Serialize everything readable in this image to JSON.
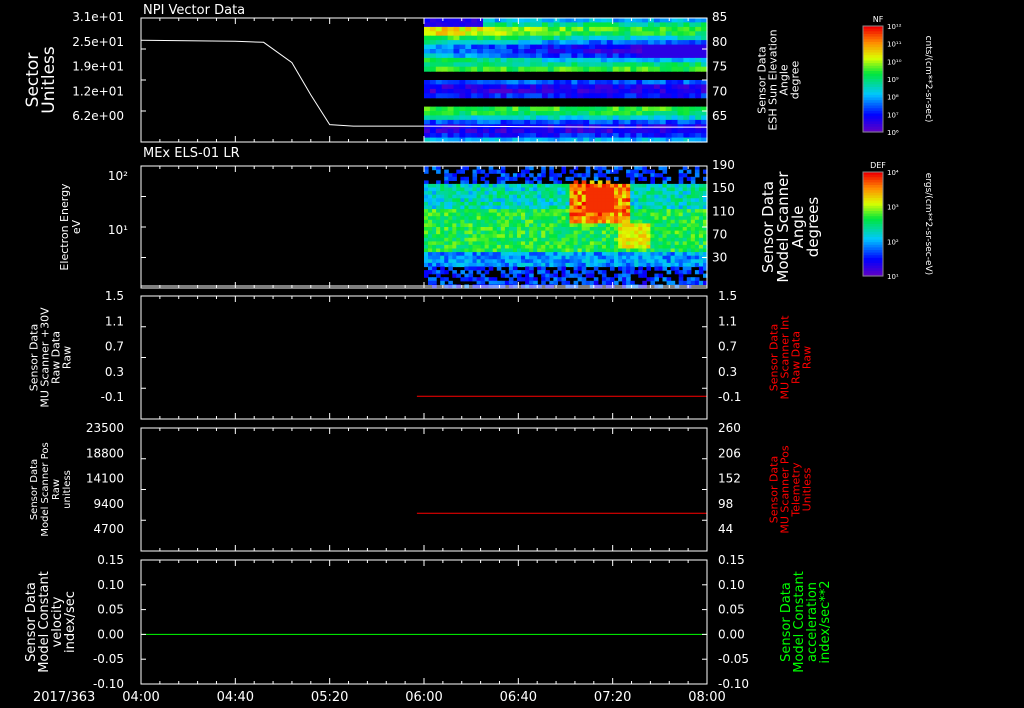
{
  "date_label": "2017/363",
  "x_ticks": [
    "04:00",
    "04:40",
    "05:20",
    "06:00",
    "06:40",
    "07:20",
    "08:00"
  ],
  "colorbars": [
    {
      "tag": "NF",
      "unit": "cnts/(cm**2-sr-sec)",
      "ticks": [
        "10¹²",
        "10¹¹",
        "10¹⁰",
        "10⁹",
        "10⁸",
        "10⁷",
        "10⁶"
      ]
    },
    {
      "tag": "DEF",
      "unit": "ergs/(cm**2-sr-sec-eV)",
      "ticks": [
        "10⁴",
        "10³",
        "10²",
        "10¹"
      ]
    }
  ],
  "colors": {
    "axes": "#ffffff",
    "red_trace": "#ff0000",
    "green_trace": "#00ff00"
  },
  "chart_data": [
    {
      "type": "heatmap",
      "title": "NPI Vector Data",
      "ylabel_left": [
        "Sector",
        "Unitless"
      ],
      "left_ticks": [
        "3.1e+01",
        "2.5e+01",
        "1.9e+01",
        "1.2e+01",
        "6.2e+00"
      ],
      "ylabel_right": [
        "Sensor Data",
        "ESH Sun Elevation",
        "Angle",
        "degree"
      ],
      "right_ticks": [
        "85",
        "80",
        "75",
        "70",
        "65"
      ],
      "right_range": [
        60,
        85
      ],
      "line_series": {
        "name": "ESH Sun Elevation Angle",
        "x": [
          "04:00",
          "04:40",
          "04:52",
          "05:04",
          "05:12",
          "05:20",
          "05:30",
          "06:00",
          "06:40",
          "07:20",
          "08:00"
        ],
        "y": [
          80.5,
          80.3,
          80.1,
          76,
          69.5,
          63.5,
          63.2,
          63.2,
          63.1,
          63.0,
          63.0
        ]
      },
      "data_start": "06:00"
    },
    {
      "type": "heatmap",
      "title": "MEx ELS-01 LR",
      "ylabel_left": [
        "Electron Energy",
        "eV"
      ],
      "left_ticks": [
        "10²",
        "10¹"
      ],
      "ylabel_right": [
        "Sensor Data",
        "Model Scanner",
        "Angle",
        "degrees"
      ],
      "right_ticks": [
        "190",
        "150",
        "110",
        "70",
        "30"
      ],
      "right_range": [
        10,
        190
      ],
      "line_series": {
        "name": "Model Scanner Angle",
        "x": [
          "04:00",
          "08:00"
        ],
        "y": [
          13,
          13
        ]
      },
      "data_start": "06:00"
    },
    {
      "type": "line",
      "ylabel_left": [
        "Sensor Data",
        "MU Scanner +30V",
        "Raw Data",
        "Raw"
      ],
      "left_ticks": [
        "1.5",
        "1.1",
        "0.7",
        "0.3",
        "-0.1"
      ],
      "ylabel_right": [
        "Sensor Data",
        "MU Scanner Int",
        "Raw Data",
        "Raw"
      ],
      "right_ticks": [
        "1.5",
        "1.1",
        "0.7",
        "0.3",
        "-0.1"
      ],
      "ylim": [
        -0.4,
        1.5
      ],
      "series": [
        {
          "name": "MU Scanner Int Raw Data",
          "x": [
            "05:57",
            "08:00"
          ],
          "y": [
            -0.05,
            -0.05
          ]
        }
      ]
    },
    {
      "type": "line",
      "ylabel_left": [
        "Sensor Data",
        "Model Scanner Pos",
        "Raw",
        "unitless"
      ],
      "left_ticks": [
        "23500",
        "18800",
        "14100",
        "9400",
        "4700"
      ],
      "ylabel_right": [
        "Sensor Data",
        "MU Scanner Pos",
        "Telemetry",
        "Unitless"
      ],
      "right_ticks": [
        "260",
        "206",
        "152",
        "98",
        "44"
      ],
      "ylim": [
        0,
        23500
      ],
      "right_ylim": [
        0,
        260
      ],
      "series": [
        {
          "name": "MU Scanner Pos Telemetry",
          "x": [
            "05:57",
            "08:00"
          ],
          "y": [
            80,
            80
          ]
        }
      ]
    },
    {
      "type": "line",
      "ylabel_left": [
        "Sensor Data",
        "Model Constant",
        "velocity",
        "index/sec"
      ],
      "left_ticks": [
        "0.15",
        "0.10",
        "0.05",
        "0.00",
        "-0.05",
        "-0.10"
      ],
      "ylabel_right": [
        "Sensor Data",
        "Model Constant",
        "acceleration",
        "index/sec**2"
      ],
      "right_ticks": [
        "0.15",
        "0.10",
        "0.05",
        "0.00",
        "-0.05",
        "-0.10"
      ],
      "ylim": [
        -0.1,
        0.15
      ],
      "series": [
        {
          "name": "Model Constant acceleration",
          "x": [
            "04:00",
            "08:00"
          ],
          "y": [
            0.0,
            0.0
          ]
        }
      ]
    }
  ]
}
